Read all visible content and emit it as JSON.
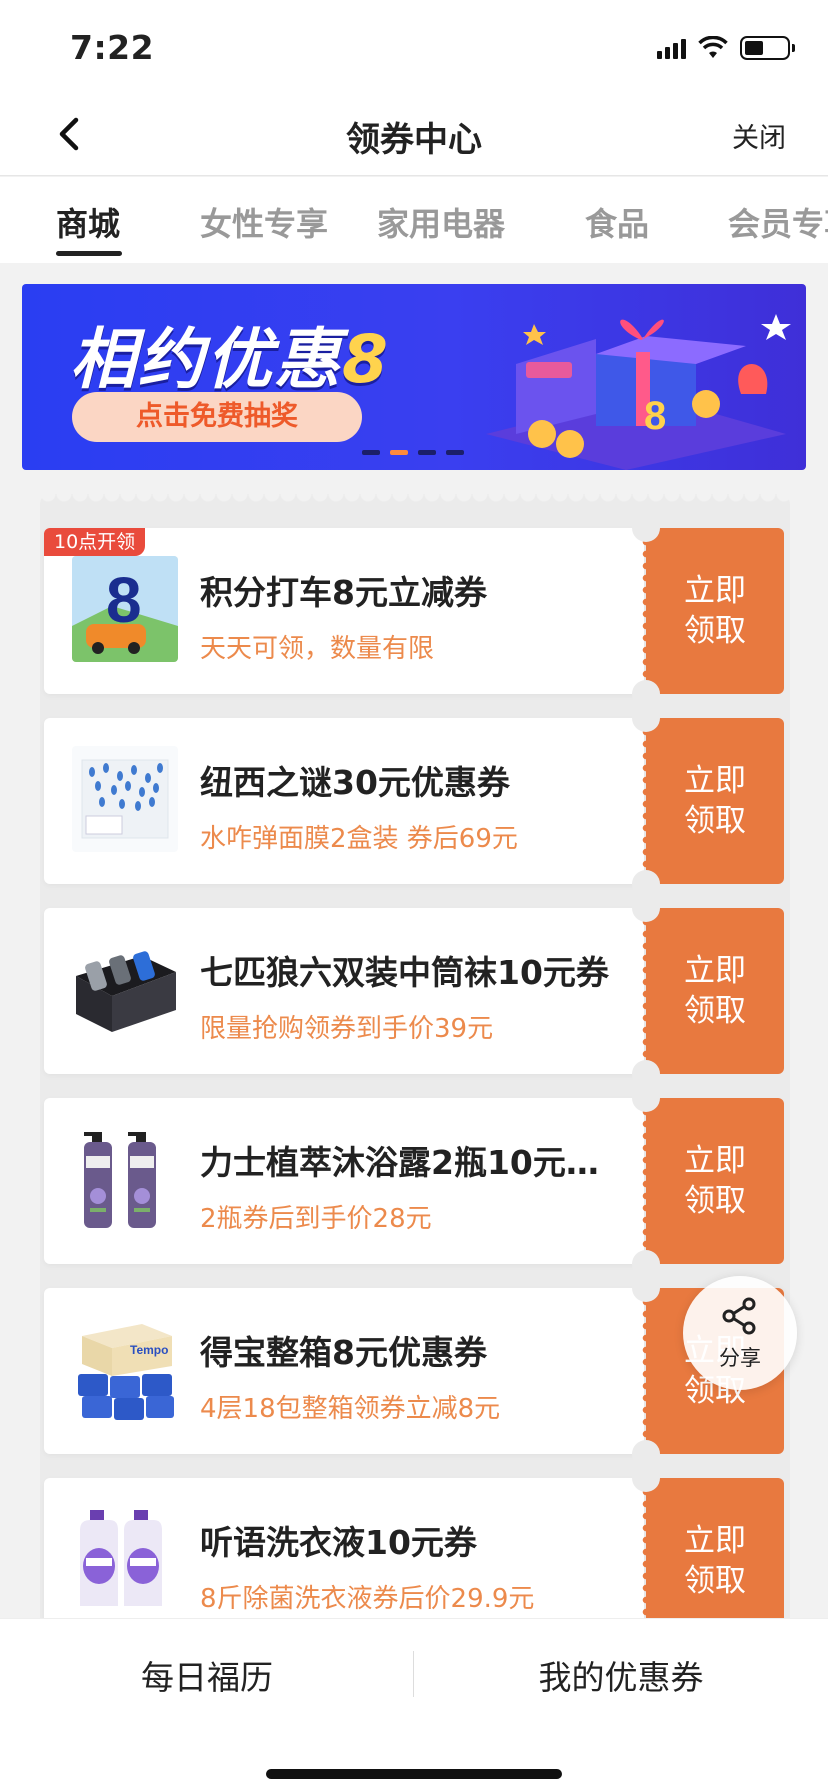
{
  "status": {
    "time": "7:22"
  },
  "nav": {
    "title": "领券中心",
    "close_label": "关闭"
  },
  "tabs": [
    {
      "label": "商城",
      "active": true
    },
    {
      "label": "女性专享",
      "active": false
    },
    {
      "label": "家用电器",
      "active": false
    },
    {
      "label": "食品",
      "active": false
    },
    {
      "label": "会员专享",
      "active": false
    }
  ],
  "banner": {
    "title_main": "相约优惠",
    "title_num": "8",
    "cta": "点击免费抽奖",
    "dots_total": 4,
    "dots_active": 2
  },
  "coupons": [
    {
      "title": "积分打车8元立减券",
      "desc": "天天可领，数量有限",
      "badge": "10点开领",
      "action": "立即\n领取",
      "thumb": "taxi-icon"
    },
    {
      "title": "纽西之谜30元优惠券",
      "desc": "水咋弹面膜2盒装 券后69元",
      "badge": "",
      "action": "立即\n领取",
      "thumb": "mask-box-icon"
    },
    {
      "title": "七匹狼六双装中筒袜10元券",
      "desc": "限量抢购领券到手价39元",
      "badge": "",
      "action": "立即\n领取",
      "thumb": "socks-box-icon"
    },
    {
      "title": "力士植萃沐浴露2瓶10元…",
      "desc": "2瓶券后到手价28元",
      "badge": "",
      "action": "立即\n领取",
      "thumb": "body-wash-icon"
    },
    {
      "title": "得宝整箱8元优惠券",
      "desc": "4层18包整箱领券立减8元",
      "badge": "",
      "action": "立即\n领取",
      "thumb": "tissue-pack-icon"
    },
    {
      "title": "听语洗衣液10元券",
      "desc": "8斤除菌洗衣液券后价29.9元",
      "badge": "",
      "action": "立即\n领取",
      "thumb": "detergent-icon"
    }
  ],
  "share": {
    "label": "分享"
  },
  "bottom": {
    "left": "每日福历",
    "right": "我的优惠券"
  },
  "colors": {
    "accent": "#e8793f",
    "desc_text": "#ec8a4c",
    "badge": "#e94b3c",
    "banner_bg": "#2a3ef2"
  }
}
